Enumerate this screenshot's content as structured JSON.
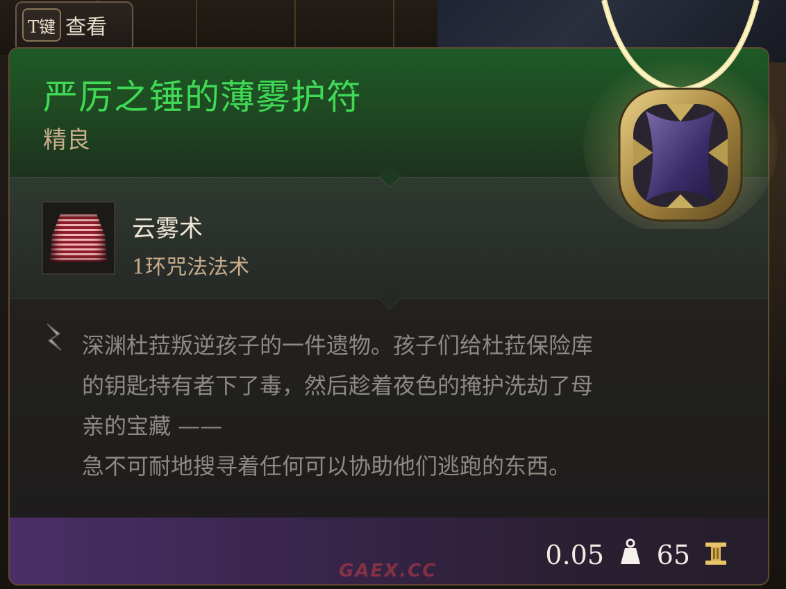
{
  "hint": {
    "key": "T键",
    "label": "查看"
  },
  "item": {
    "name": "严厉之锤的薄雾护符",
    "rarity": "精良",
    "icon": "amulet-icon"
  },
  "spell": {
    "name": "云雾术",
    "level": "1环咒法法术",
    "icon": "fog-cloud-spell-icon"
  },
  "lore": {
    "text": "深渊杜菈叛逆孩子的一件遗物。孩子们给杜菈保险库\n的钥匙持有者下了毒，然后趁着夜色的掩护洗劫了母\n亲的宝藏 ——\n急不可耐地搜寻着任何可以协助他们逃跑的东西。",
    "icon": "lore-scroll-icon"
  },
  "stats": {
    "weight": "0.05",
    "weight_icon": "weight-icon",
    "price": "65",
    "price_icon": "gold-icon"
  },
  "watermark": "GAEX.CC",
  "colors": {
    "title": "#3fd955",
    "rarity": "#c7ad8c",
    "header_bg": "#1e5a27",
    "footer_bg": "#4a2f66"
  }
}
